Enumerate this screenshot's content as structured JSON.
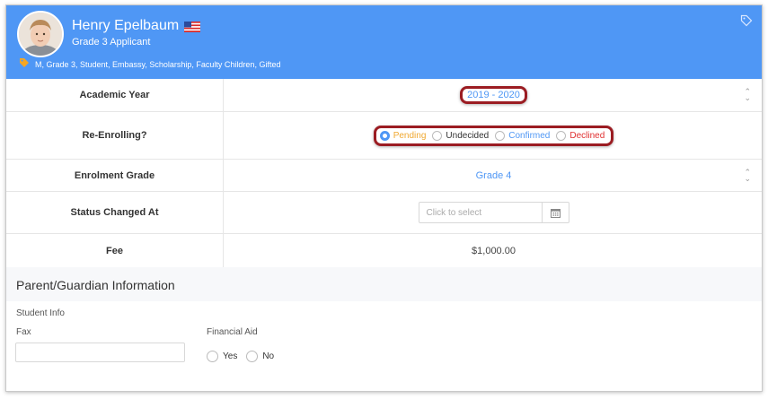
{
  "student": {
    "name": "Henry Epelbaum",
    "subtitle": "Grade 3 Applicant",
    "tags": "M, Grade 3, Student,  Embassy,  Scholarship,  Faculty Children,  Gifted"
  },
  "form": {
    "academic_year": {
      "label": "Academic Year",
      "value": "2019 - 2020"
    },
    "re_enrolling": {
      "label": "Re-Enrolling?",
      "options": [
        "Pending",
        "Undecided",
        "Confirmed",
        "Declined"
      ],
      "selected": "Pending"
    },
    "enrolment_grade": {
      "label": "Enrolment Grade",
      "value": "Grade 4"
    },
    "status_changed_at": {
      "label": "Status Changed At",
      "placeholder": "Click to select"
    },
    "fee": {
      "label": "Fee",
      "value": "$1,000.00"
    }
  },
  "parent_section": {
    "title": "Parent/Guardian Information",
    "student_info_label": "Student Info",
    "fax_label": "Fax",
    "financial_aid_label": "Financial Aid",
    "aid_options": [
      "Yes",
      "No"
    ]
  },
  "colors": {
    "header_bg": "#4f97f5",
    "highlight": "#9b1c22",
    "pending": "#f0a830",
    "confirmed": "#4f97f5",
    "declined": "#e03030",
    "tag_icon": "#f5a623"
  }
}
